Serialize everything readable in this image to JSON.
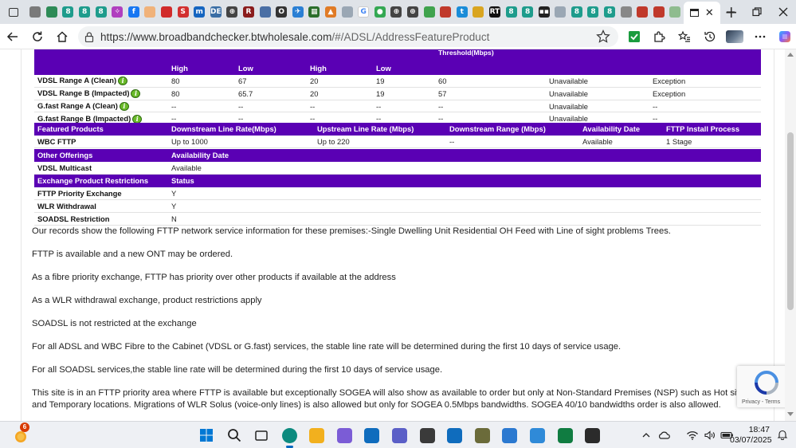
{
  "browser": {
    "url": "https://www.broadbandchecker.btwholesale.com/#/ADSL/AddressFeatureProduct",
    "url_host": "https://www.broadbandchecker.btwholesale.com",
    "url_path": "/#/ADSL/AddressFeatureProduct",
    "tab_icons": [
      {
        "name": "page-icon",
        "color": "#7a7a7a",
        "glyph": ""
      },
      {
        "name": "green-app-icon",
        "color": "#2e8b57",
        "glyph": ""
      },
      {
        "name": "eight-ball-icon",
        "color": "#1e9c8c",
        "glyph": "8"
      },
      {
        "name": "eight-ball-icon",
        "color": "#1e9c8c",
        "glyph": "8"
      },
      {
        "name": "eight-ball-icon",
        "color": "#1e9c8c",
        "glyph": "8"
      },
      {
        "name": "puzzle-icon",
        "color": "#b03fbf",
        "glyph": "✧"
      },
      {
        "name": "facebook-icon",
        "color": "#1877f2",
        "glyph": "f"
      },
      {
        "name": "document-icon",
        "color": "#f0b27a",
        "glyph": ""
      },
      {
        "name": "red-flag-icon",
        "color": "#d12b2b",
        "glyph": ""
      },
      {
        "name": "s-icon",
        "color": "#d23030",
        "glyph": "S"
      },
      {
        "name": "m-icon",
        "color": "#1565c0",
        "glyph": "m"
      },
      {
        "name": "de-icon",
        "color": "#3a6ea5",
        "glyph": "DE"
      },
      {
        "name": "globe-icon",
        "color": "#444444",
        "glyph": "⊕"
      },
      {
        "name": "rr-icon",
        "color": "#8a1c1c",
        "glyph": "R"
      },
      {
        "name": "bird-icon",
        "color": "#4a6fa5",
        "glyph": ""
      },
      {
        "name": "o-search-icon",
        "color": "#333333",
        "glyph": "O"
      },
      {
        "name": "plane-icon",
        "color": "#2a7fd4",
        "glyph": "✈"
      },
      {
        "name": "grid-icon",
        "color": "#2b6e2b",
        "glyph": "▦"
      },
      {
        "name": "triangle-icon",
        "color": "#e07b26",
        "glyph": "▲"
      },
      {
        "name": "pages-icon",
        "color": "#9aa7b4",
        "glyph": ""
      },
      {
        "name": "google-icon",
        "color": "#ffffff",
        "glyph": "G"
      },
      {
        "name": "maps-pin-icon",
        "color": "#34a853",
        "glyph": "●"
      },
      {
        "name": "globe-icon",
        "color": "#444444",
        "glyph": "⊕"
      },
      {
        "name": "globe-icon",
        "color": "#444444",
        "glyph": "⊕"
      },
      {
        "name": "puzzle-app-icon",
        "color": "#3fa34d",
        "glyph": ""
      },
      {
        "name": "stripe-icon",
        "color": "#c0392b",
        "glyph": ""
      },
      {
        "name": "tc-icon",
        "color": "#1a8cd8",
        "glyph": "t"
      },
      {
        "name": "image-icon",
        "color": "#d9a520",
        "glyph": ""
      },
      {
        "name": "rt-icon",
        "color": "#111111",
        "glyph": "RT"
      },
      {
        "name": "eight-ball-icon",
        "color": "#1e9c8c",
        "glyph": "8"
      },
      {
        "name": "eight-ball-grid-icon",
        "color": "#1e9c8c",
        "glyph": "8"
      },
      {
        "name": "dots-icon",
        "color": "#222222",
        "glyph": "▪▪"
      },
      {
        "name": "page-icon",
        "color": "#9aa7b4",
        "glyph": ""
      },
      {
        "name": "eight-ball-icon",
        "color": "#1e9c8c",
        "glyph": "8"
      },
      {
        "name": "eight-ball-icon",
        "color": "#1e9c8c",
        "glyph": "8"
      },
      {
        "name": "eight-ball-icon",
        "color": "#1e9c8c",
        "glyph": "8"
      },
      {
        "name": "tools-icon",
        "color": "#888888",
        "glyph": ""
      },
      {
        "name": "chart-icon",
        "color": "#c0392b",
        "glyph": ""
      },
      {
        "name": "pdf-icon",
        "color": "#c0392b",
        "glyph": ""
      },
      {
        "name": "leaf-icon",
        "color": "#8fbc8f",
        "glyph": ""
      }
    ]
  },
  "tables": {
    "threshold": {
      "top_label": "Threshold(Mbps)",
      "subheaders": [
        "",
        "High",
        "Low",
        "High",
        "Low",
        "",
        "",
        ""
      ],
      "rows": [
        {
          "label": "VDSL Range A (Clean)",
          "info": true,
          "cells": [
            "80",
            "67",
            "20",
            "19",
            "60",
            "Unavailable",
            "Exception"
          ]
        },
        {
          "label": "VDSL Range B (Impacted)",
          "info": true,
          "cells": [
            "80",
            "65.7",
            "20",
            "19",
            "57",
            "Unavailable",
            "Exception"
          ]
        },
        {
          "label": "G.fast Range A (Clean)",
          "info": true,
          "cells": [
            "--",
            "--",
            "--",
            "--",
            "--",
            "Unavailable",
            "--"
          ]
        },
        {
          "label": "G.fast Range B (Impacted)",
          "info": true,
          "cells": [
            "--",
            "--",
            "--",
            "--",
            "--",
            "Unavailable",
            "--"
          ]
        }
      ]
    },
    "featured": {
      "headers": [
        "Featured Products",
        "Downstream Line Rate(Mbps)",
        "Upstream Line Rate (Mbps)",
        "Downstream Range (Mbps)",
        "Availability Date",
        "FTTP Install Process"
      ],
      "rows": [
        {
          "cells": [
            "WBC FTTP",
            "Up to 1000",
            "Up to 220",
            "--",
            "Available",
            "1 Stage"
          ]
        }
      ]
    },
    "other": {
      "headers": [
        "Other Offerings",
        "Availability Date"
      ],
      "rows": [
        {
          "cells": [
            "VDSL Multicast",
            "Available"
          ]
        }
      ]
    },
    "restrictions": {
      "headers": [
        "Exchange Product Restrictions",
        "Status"
      ],
      "rows": [
        {
          "cells": [
            "FTTP Priority Exchange",
            "Y"
          ]
        },
        {
          "cells": [
            "WLR Withdrawal",
            "Y"
          ]
        },
        {
          "cells": [
            "SOADSL Restriction",
            "N"
          ]
        }
      ]
    }
  },
  "paragraphs": [
    "Our records show the following FTTP network service information for these premises:-Single Dwelling Unit Residential OH Feed with Line of sight problems Trees.",
    "FTTP is available and a new ONT may be ordered.",
    "As a fibre priority exchange, FTTP has priority over other products if available at the address",
    "As a WLR withdrawal exchange, product restrictions apply",
    "SOADSL is not restricted at the exchange",
    "For all ADSL and WBC Fibre to the Cabinet (VDSL or G.fast) services, the stable line rate will be determined during the first 10 days of service usage.",
    "For all SOADSL services,the stable line rate will be determined during the first 10 days of service usage.",
    "This site is in an FTTP priority area where FTTP is available but exceptionally SOGEA will also show as available to order but only at Non-Standard Premises (NSP) such as Hot site, Uninhab",
    "and Temporary locations. Migrations of WLR Solus (voice-only lines) is also allowed but only for SOGEA 0.5Mbps bandwidths. SOGEA 40/10 bandwidths order is also allowed."
  ],
  "recaptcha": {
    "terms": "Privacy - Terms"
  },
  "taskbar": {
    "notification_count": "6",
    "time": "18:47",
    "date": "03/07/2025",
    "apps": [
      {
        "name": "start-button",
        "color": "#0078d4"
      },
      {
        "name": "search-button",
        "color": "#222222"
      },
      {
        "name": "task-view-button",
        "color": "#222222"
      },
      {
        "name": "edge-app",
        "color": "#0c8a7e",
        "active": true
      },
      {
        "name": "file-explorer-app",
        "color": "#f2b01e"
      },
      {
        "name": "copilot-app",
        "color": "#7b5cd6"
      },
      {
        "name": "outlook-new-app",
        "color": "#0f6cbd"
      },
      {
        "name": "teams-app",
        "color": "#5b5fc7"
      },
      {
        "name": "paw-app",
        "color": "#3a3a3a"
      },
      {
        "name": "outlook-app",
        "color": "#0f6cbd"
      },
      {
        "name": "s-app",
        "color": "#6b6b3a"
      },
      {
        "name": "store-app",
        "color": "#2b79d0"
      },
      {
        "name": "photos-app",
        "color": "#2f8ad8"
      },
      {
        "name": "excel-app",
        "color": "#107c41"
      },
      {
        "name": "terminal-app",
        "color": "#2b2b2b"
      }
    ]
  },
  "colors": {
    "header_purple": "#5a00b4",
    "accent": "#0067c0"
  }
}
